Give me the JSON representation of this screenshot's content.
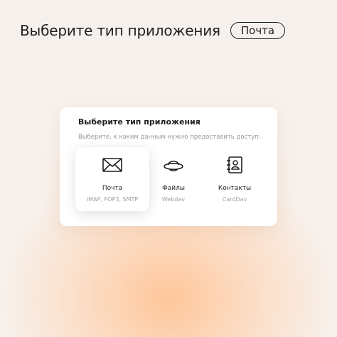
{
  "headline": {
    "text": "Выберите тип приложения",
    "pill_label": "Почта"
  },
  "card": {
    "title": "Выберите тип приложения",
    "subtitle": "Выберите, к каким данным нужно предоставить доступ:",
    "options": [
      {
        "label": "Почта",
        "protocols": "IMAP, POP3, SMTP",
        "icon": "mail-icon",
        "selected": true
      },
      {
        "label": "Файлы",
        "protocols": "Webdav",
        "icon": "disk-ufo-icon",
        "selected": false
      },
      {
        "label": "Контакты",
        "protocols": "CardDav",
        "icon": "contacts-book-icon",
        "selected": false
      }
    ]
  }
}
